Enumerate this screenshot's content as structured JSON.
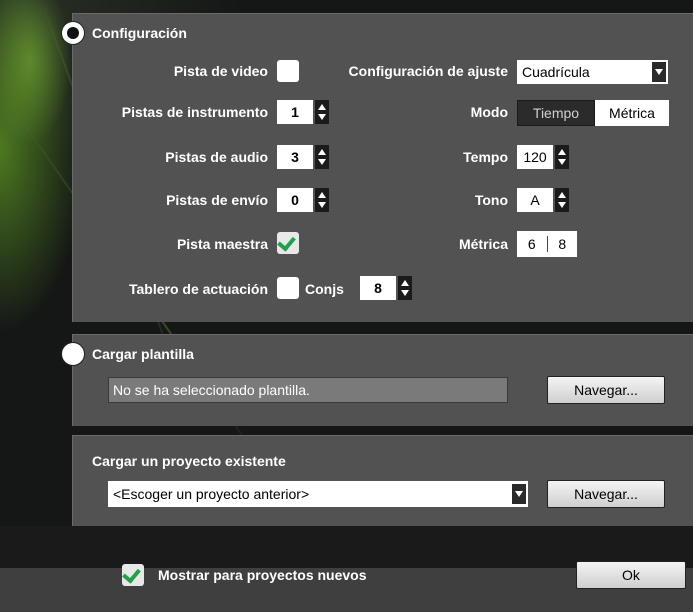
{
  "colors": {
    "accent": "#1fa24a",
    "panel": "#525252",
    "background": "#151716"
  },
  "config": {
    "title": "Configuración",
    "pista_video_label": "Pista de video",
    "config_ajuste_label": "Configuración de ajuste",
    "config_ajuste_value": "Cuadrícula",
    "pistas_instrumento_label": "Pistas de instrumento",
    "pistas_instrumento_value": "1",
    "modo_label": "Modo",
    "modo_options": [
      "Tiempo",
      "Métrica"
    ],
    "modo_selected": "Métrica",
    "pistas_audio_label": "Pistas de audio",
    "pistas_audio_value": "3",
    "tempo_label": "Tempo",
    "tempo_value": "120",
    "pistas_envio_label": "Pistas de envío",
    "pistas_envio_value": "0",
    "tono_label": "Tono",
    "tono_value": "A",
    "pista_maestra_label": "Pista maestra",
    "metrica_label": "Métrica",
    "metrica_num": "6",
    "metrica_den": "8",
    "tablero_label": "Tablero de actuación",
    "conjs_label": "Conjs",
    "conjs_value": "8"
  },
  "template": {
    "title": "Cargar plantilla",
    "field_value": "No se ha seleccionado plantilla.",
    "browse_label": "Navegar..."
  },
  "project": {
    "title": "Cargar un proyecto existente",
    "select_value": "<Escoger un proyecto anterior>",
    "browse_label": "Navegar..."
  },
  "footer": {
    "show_new_label": "Mostrar para proyectos nuevos",
    "ok_label": "Ok"
  }
}
